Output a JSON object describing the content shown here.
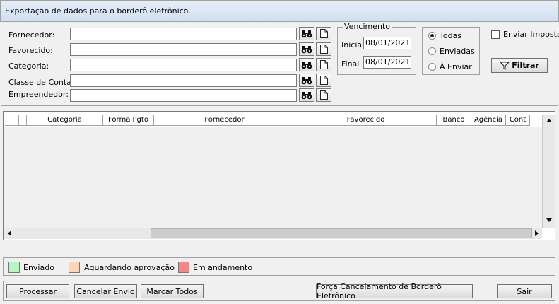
{
  "window": {
    "title": "Exportação de dados para o borderô eletrônico."
  },
  "filters": {
    "fornecedor_label": "Fornecedor:",
    "favorecido_label": "Favorecido:",
    "categoria_label": "Categoria:",
    "classe_label": "Classe de Conta:",
    "empreendedor_label": "Empreendedor:",
    "fornecedor_value": "",
    "favorecido_value": "",
    "categoria_value": "",
    "classe_value": "",
    "empreendedor_value": ""
  },
  "vencimento": {
    "title": "Vencimento",
    "inicial_label": "Inicial",
    "inicial_value": "08/01/2021",
    "final_label": "Final",
    "final_value": "08/01/2021"
  },
  "status_options": {
    "todas": "Todas",
    "enviadas": "Enviadas",
    "a_enviar": "À Enviar",
    "selected": "Todas"
  },
  "enviar_imposto_label": "Enviar Imposto",
  "filtrar_label": "Filtrar",
  "grid": {
    "columns": [
      "",
      "",
      "Categoria",
      "Forma Pgto",
      "Fornecedor",
      "Favorecido",
      "Banco",
      "Agência",
      "Cont"
    ],
    "rows": []
  },
  "legend": [
    {
      "label": "Enviado",
      "color": "#b6f5be"
    },
    {
      "label": "Aguardando aprovação",
      "color": "#fbd6b4"
    },
    {
      "label": "Em andamento",
      "color": "#f88686"
    }
  ],
  "actions": {
    "processar": "Processar",
    "cancelar_envio": "Cancelar Envio",
    "marcar_todos": "Marcar Todos",
    "forca_cancelamento": "Força Cancelamento de Borderô Eletrônico",
    "sair": "Sair"
  },
  "icons": {
    "search": "binoculars-icon",
    "new": "blank-document-icon",
    "filter": "funnel-icon"
  }
}
